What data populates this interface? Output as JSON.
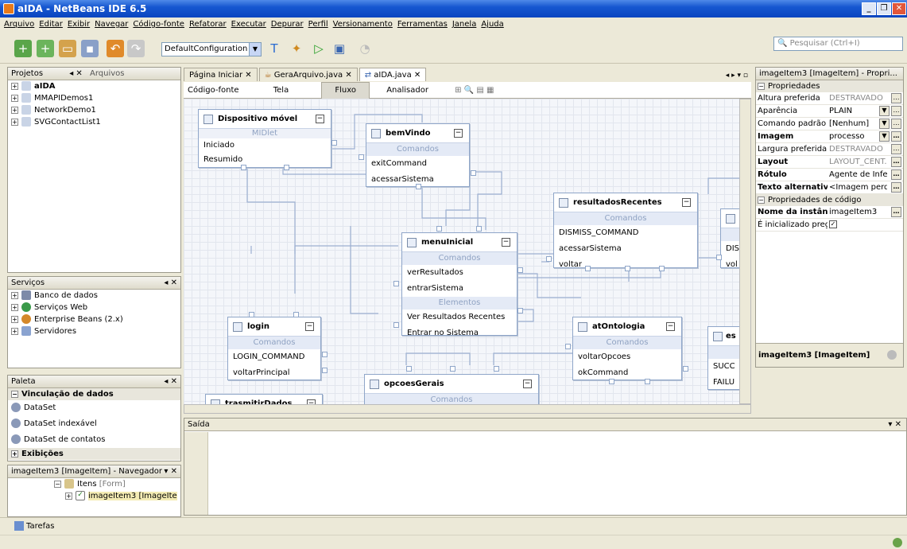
{
  "window": {
    "title": "aIDA - NetBeans IDE 6.5"
  },
  "menu": [
    "Arquivo",
    "Editar",
    "Exibir",
    "Navegar",
    "Código-fonte",
    "Refatorar",
    "Executar",
    "Depurar",
    "Perfil",
    "Versionamento",
    "Ferramentas",
    "Janela",
    "Ajuda"
  ],
  "toolbar": {
    "config": "DefaultConfiguration",
    "search_placeholder": "Pesquisar (Ctrl+I)"
  },
  "projects": {
    "tab1": "Projetos",
    "tab2": "Arquivos",
    "items": [
      "aIDA",
      "MMAPIDemos1",
      "NetworkDemo1",
      "SVGContactList1"
    ]
  },
  "services": {
    "title": "Serviços",
    "items": [
      "Banco de dados",
      "Serviços Web",
      "Enterprise Beans (2.x)",
      "Servidores"
    ]
  },
  "palette": {
    "title": "Paleta",
    "cat1": "Vinculação de dados",
    "items": [
      "DataSet",
      "DataSet indexável",
      "DataSet de contatos"
    ],
    "cat2": "Exibições"
  },
  "navigator": {
    "title": "imageItem3 [ImageItem] - Navegador",
    "row1": "Itens",
    "row1b": "[Form]",
    "row2": "imageItem3 [ImageIte"
  },
  "editor": {
    "tabs": [
      "Página Iniciar",
      "GeraArquivo.java",
      "aIDA.java"
    ],
    "subtabs": [
      "Código-fonte",
      "Tela",
      "Fluxo",
      "Analisador"
    ]
  },
  "nodes": {
    "dispositivo": {
      "title": "Dispositivo móvel",
      "sec": "MIDlet",
      "rows": [
        "Iniciado",
        "Resumido"
      ]
    },
    "bemvindo": {
      "title": "bemVindo",
      "sec": "Comandos",
      "rows": [
        "exitCommand",
        "acessarSistema"
      ]
    },
    "resultados": {
      "title": "resultadosRecentes",
      "sec": "Comandos",
      "rows": [
        "DISMISS_COMMAND",
        "acessarSistema",
        "voltar"
      ]
    },
    "menu": {
      "title": "menuInicial",
      "sec1": "Comandos",
      "rows1": [
        "verResultados",
        "entrarSistema"
      ],
      "sec2": "Elementos",
      "rows2": [
        "Ver Resultados Recentes",
        "Entrar no Sistema"
      ]
    },
    "login": {
      "title": "login",
      "sec": "Comandos",
      "rows": [
        "LOGIN_COMMAND",
        "voltarPrincipal"
      ]
    },
    "ontologia": {
      "title": "atOntologia",
      "sec": "Comandos",
      "rows": [
        "voltarOpcoes",
        "okCommand"
      ]
    },
    "opcoes": {
      "title": "opcoesGerais",
      "sec": "Comandos"
    },
    "transmitir": {
      "title": "trasmitirDados"
    },
    "partial1": {
      "rows": [
        "DIS",
        "vol"
      ]
    },
    "partial2": {
      "title": "es",
      "rows": [
        "SUCC",
        "FAILU"
      ]
    }
  },
  "output": {
    "title": "Saída"
  },
  "tasks": {
    "label": "Tarefas"
  },
  "properties": {
    "title": "imageItem3 [ImageItem] - Propri...",
    "group1": "Propriedades",
    "rows": [
      {
        "k": "Altura preferida",
        "v": "DESTRAVADO"
      },
      {
        "k": "Aparência",
        "v": "PLAIN"
      },
      {
        "k": "Comando padrão",
        "v": "[Nenhum]"
      },
      {
        "k": "Imagem",
        "v": "processo"
      },
      {
        "k": "Largura preferida",
        "v": "DESTRAVADO"
      },
      {
        "k": "Layout",
        "v": "LAYOUT_CENT..."
      },
      {
        "k": "Rótulo",
        "v": "Agente de Infe..."
      },
      {
        "k": "Texto alternativo",
        "v": "<Imagem perdi..."
      }
    ],
    "group2": "Propriedades de código",
    "rows2": [
      {
        "k": "Nome da instância",
        "v": "imageItem3"
      },
      {
        "k": "É inicializado preguiço",
        "v": ""
      }
    ],
    "footer": "imageItem3 [ImageItem]"
  }
}
